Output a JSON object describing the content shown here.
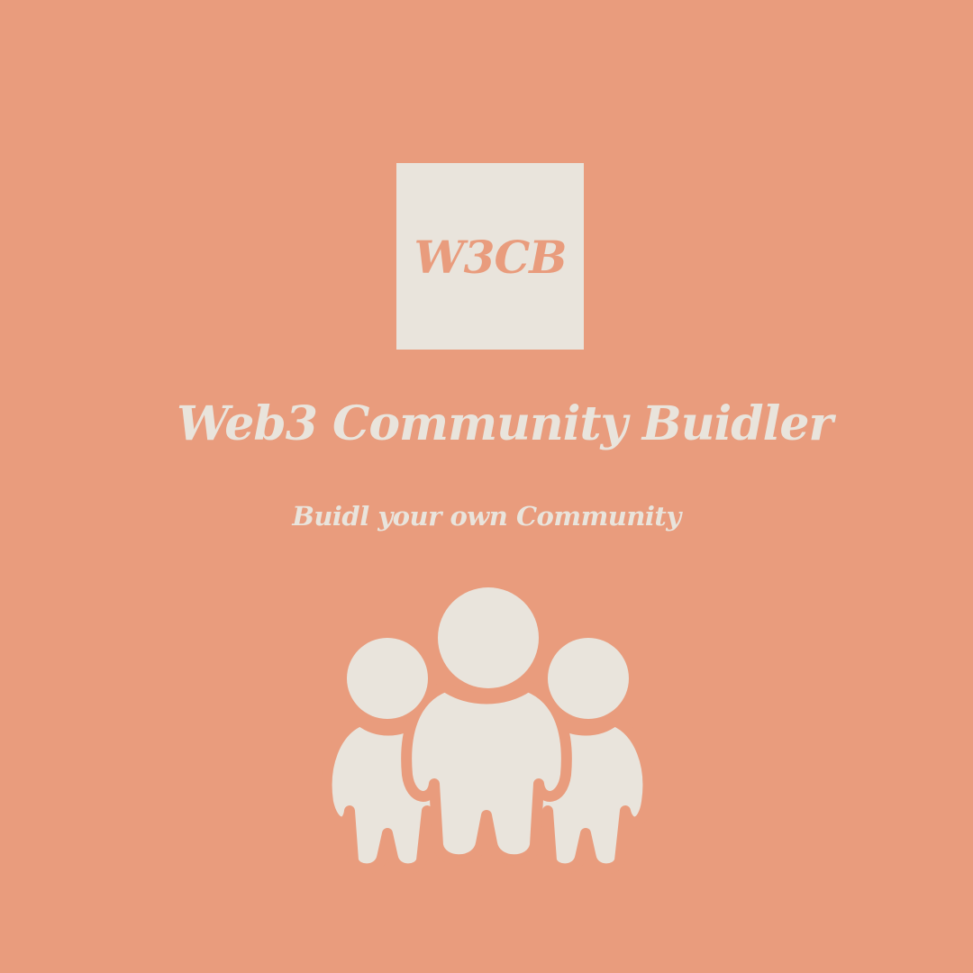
{
  "logo": {
    "text": "W3CB"
  },
  "title": "Web3 Community Buidler",
  "subtitle": "Buidl your own Community",
  "icon": {
    "name": "community-people-icon"
  },
  "colors": {
    "background": "#E99C7D",
    "foreground": "#E9E4DC"
  }
}
